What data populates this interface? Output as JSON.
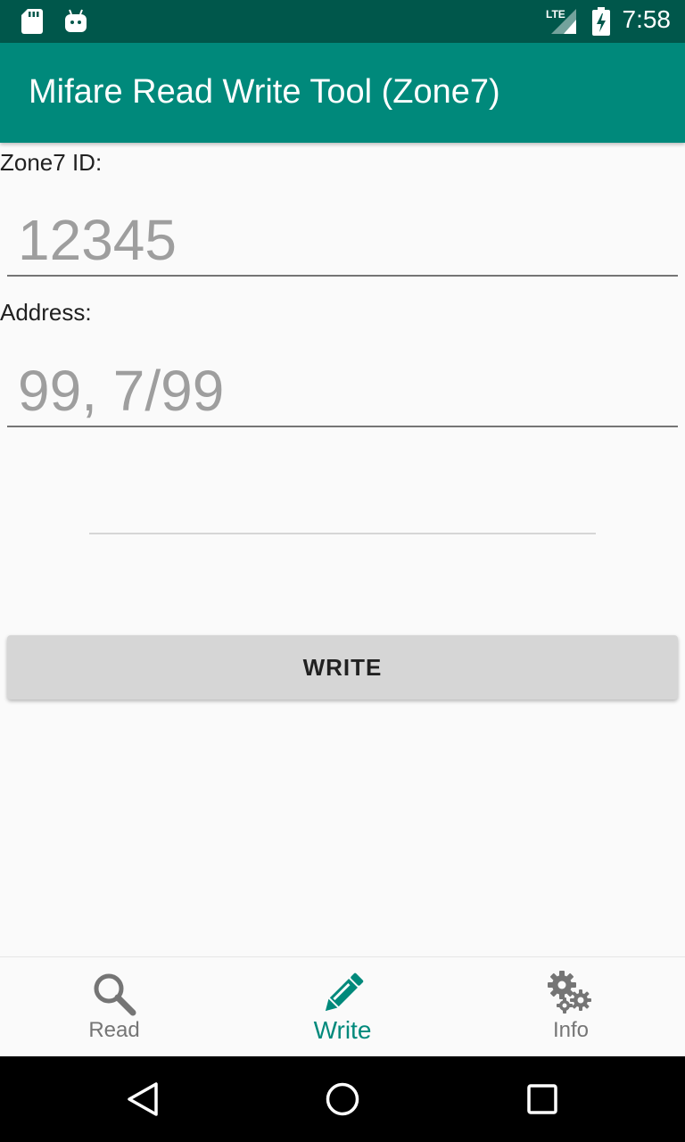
{
  "status_bar": {
    "time": "7:58",
    "network_label": "LTE",
    "icons": [
      "sd-card-icon",
      "android-icon",
      "lte-signal-icon",
      "battery-charging-icon"
    ]
  },
  "app_bar": {
    "title": "Mifare Read Write Tool (Zone7)"
  },
  "form": {
    "zone_id_label": "Zone7 ID:",
    "zone_id_placeholder": "12345",
    "zone_id_value": "",
    "address_label": "Address:",
    "address_placeholder": "99, 7/99",
    "address_value": "",
    "result_text": ""
  },
  "actions": {
    "write_label": "WRITE"
  },
  "bottom_nav": {
    "active": "write",
    "items": [
      {
        "id": "read",
        "label": "Read",
        "icon": "search-icon"
      },
      {
        "id": "write",
        "label": "Write",
        "icon": "pencil-icon"
      },
      {
        "id": "info",
        "label": "Info",
        "icon": "gears-icon"
      }
    ]
  },
  "colors": {
    "primary": "#00897b",
    "primary_dark": "#00574b",
    "button_bg": "#d6d6d6",
    "inactive_nav": "#757575"
  }
}
